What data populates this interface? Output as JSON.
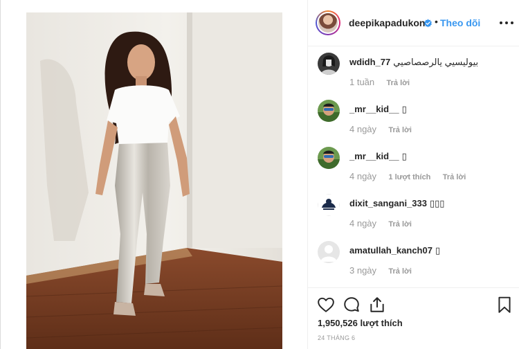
{
  "post": {
    "author": "deepikapadukone",
    "follow_label": "Theo dõi",
    "separator": "•",
    "likes": "1,950,526 lượt thích",
    "date": "24 THÁNG 6",
    "verified_icon": "verified-badge-icon"
  },
  "comments": [
    {
      "user": "wdidh_77",
      "text": "بيوليسيي يالرصصاصيي",
      "time": "1 tuần",
      "likes_label": "",
      "reply_label": "Trả lời"
    },
    {
      "user": "_mr__kid__",
      "text": "▯",
      "time": "4 ngày",
      "likes_label": "",
      "reply_label": "Trả lời"
    },
    {
      "user": "_mr__kid__",
      "text": "▯",
      "time": "4 ngày",
      "likes_label": "1 lượt thích",
      "reply_label": "Trả lời"
    },
    {
      "user": "dixit_sangani_333",
      "text": "▯▯▯",
      "time": "4 ngày",
      "likes_label": "",
      "reply_label": "Trả lời"
    },
    {
      "user": "amatullah_kanch07",
      "text": "▯",
      "time": "3 ngày",
      "likes_label": "",
      "reply_label": "Trả lời"
    }
  ],
  "colors": {
    "link_blue": "#3897f0",
    "text_primary": "#262626",
    "text_secondary": "#999999",
    "border": "#efefef"
  }
}
